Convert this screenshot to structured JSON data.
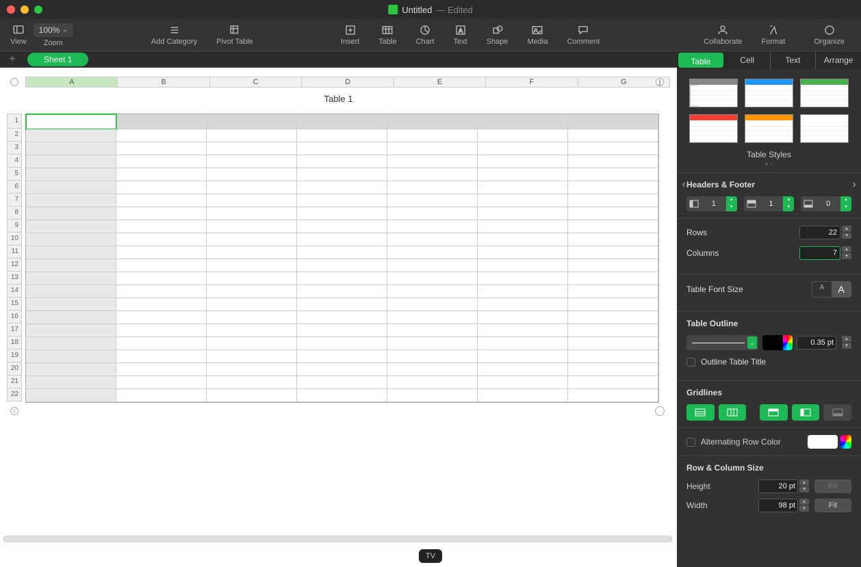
{
  "title": {
    "name": "Untitled",
    "status": "— Edited"
  },
  "toolbar": {
    "view": "View",
    "zoom_label": "Zoom",
    "zoom_value": "100%",
    "add_category": "Add Category",
    "pivot_table": "Pivot Table",
    "insert": "Insert",
    "table": "Table",
    "chart": "Chart",
    "text": "Text",
    "shape": "Shape",
    "media": "Media",
    "comment": "Comment",
    "collaborate": "Collaborate",
    "format": "Format",
    "organize": "Organize"
  },
  "sheets": {
    "sheet1": "Sheet 1"
  },
  "table": {
    "title": "Table 1",
    "columns": [
      "A",
      "B",
      "C",
      "D",
      "E",
      "F",
      "G"
    ],
    "rows": [
      "1",
      "2",
      "3",
      "4",
      "5",
      "6",
      "7",
      "8",
      "9",
      "10",
      "11",
      "12",
      "13",
      "14",
      "15",
      "16",
      "17",
      "18",
      "19",
      "20",
      "21",
      "22"
    ]
  },
  "panel": {
    "tabs": {
      "table": "Table",
      "cell": "Cell",
      "text": "Text",
      "arrange": "Arrange"
    },
    "styles_label": "Table Styles",
    "headers_footer": "Headers & Footer",
    "hf": {
      "hcols": "1",
      "hrows": "1",
      "footer": "0"
    },
    "rows_label": "Rows",
    "rows_val": "22",
    "cols_label": "Columns",
    "cols_val": "7",
    "font_size_label": "Table Font Size",
    "outline_label": "Table Outline",
    "outline_pt": "0.35 pt",
    "outline_title": "Outline Table Title",
    "gridlines_label": "Gridlines",
    "alt_label": "Alternating Row Color",
    "size_label": "Row & Column Size",
    "height_label": "Height",
    "height_val": "20 pt",
    "width_label": "Width",
    "width_val": "98 pt",
    "fit": "Fit"
  },
  "dock": {
    "tv": "TV"
  }
}
